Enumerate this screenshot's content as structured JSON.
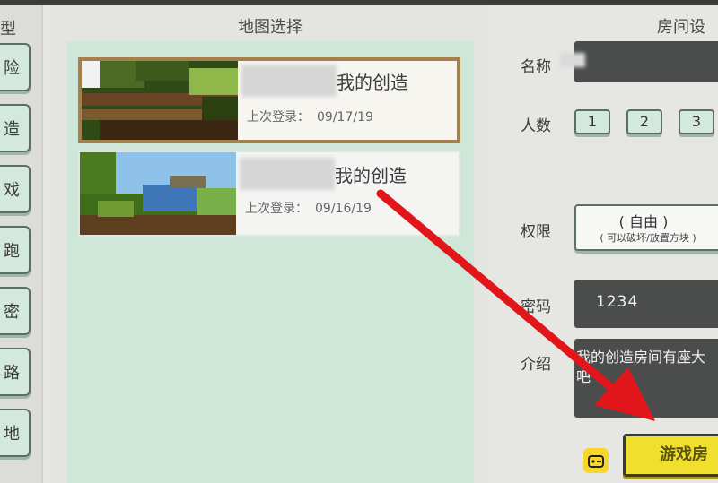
{
  "left_panel": {
    "title": "型",
    "buttons": [
      "险",
      "造",
      "戏",
      "跑",
      "密",
      "路",
      "地"
    ]
  },
  "map_select": {
    "title": "地图选择",
    "maps": [
      {
        "name": "我的创造",
        "last_login_label": "上次登录：",
        "last_login": "09/17/19",
        "selected": true
      },
      {
        "name": "我的创造",
        "last_login_label": "上次登录：",
        "last_login": "09/16/19",
        "selected": false
      }
    ]
  },
  "room_settings": {
    "title": "房间设",
    "name_label": "名称",
    "count_label": "人数",
    "count_options": [
      "1",
      "2",
      "3"
    ],
    "permission_label": "权限",
    "permission_value": "( 自由 )",
    "permission_desc": "( 可以破坏/放置方块 )",
    "password_label": "密码",
    "password_value": "1234",
    "intro_label": "介绍",
    "intro_value": "我的创造房间有座大\n吧",
    "create_button": "游戏房"
  },
  "colors": {
    "list_bg": "#cfe7d9",
    "selected_border": "#a6804a",
    "button_yellow": "#f1df2f",
    "arrow_red": "#e0161b"
  }
}
